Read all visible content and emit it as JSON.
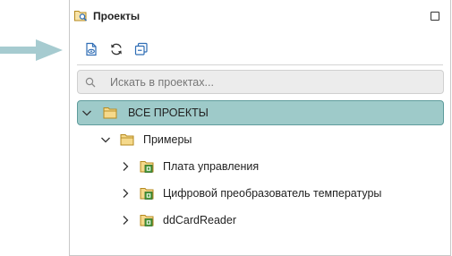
{
  "panel": {
    "title": "Проекты",
    "header_icon": "projects-panel-icon",
    "maximize_icon": "maximize-icon"
  },
  "toolbar": {
    "buttons": [
      {
        "icon": "show-file-icon"
      },
      {
        "icon": "refresh-icon"
      },
      {
        "icon": "collapse-all-icon"
      }
    ]
  },
  "search": {
    "placeholder": "Искать в проектах...",
    "value": ""
  },
  "tree": {
    "root": {
      "label": "ВСЕ ПРОЕКТЫ",
      "expanded": true,
      "selected": true,
      "icon": "folder-icon"
    },
    "group": {
      "label": "Примеры",
      "expanded": true,
      "icon": "folder-icon"
    },
    "projects": [
      {
        "label": "Плата управления",
        "expanded": false,
        "icon": "project-icon"
      },
      {
        "label": "Цифровой преобразователь температуры",
        "expanded": false,
        "icon": "project-icon"
      },
      {
        "label": "ddCardReader",
        "expanded": false,
        "icon": "project-icon"
      }
    ]
  },
  "colors": {
    "selection_bg": "#9ecac9",
    "selection_border": "#5e9c9c",
    "folder_yellow": "#f5d98b",
    "project_green": "#4a9a3c",
    "toolbar_blue": "#2f6db5",
    "pointer_arrow": "#a6cbd0"
  }
}
